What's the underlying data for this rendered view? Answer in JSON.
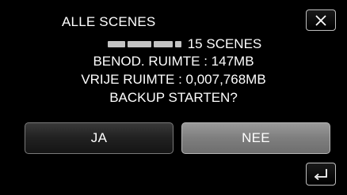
{
  "dialog": {
    "title": "ALLE SCENES",
    "scene_count": "15 SCENES",
    "used_space": "BENOD. RUIMTE : 147MB",
    "free_space": "VRIJE RUIMTE : 0,007,768MB",
    "question": "BACKUP STARTEN?"
  },
  "buttons": {
    "yes_label": "JA",
    "no_label": "NEE"
  },
  "icons": {
    "close": "close-icon",
    "back": "return-arrow-icon"
  },
  "colors": {
    "background": "#000000",
    "text": "#ffffff",
    "button_dark": "#222222",
    "button_selected": "#7e7e7e",
    "border": "#bfbfbf"
  }
}
